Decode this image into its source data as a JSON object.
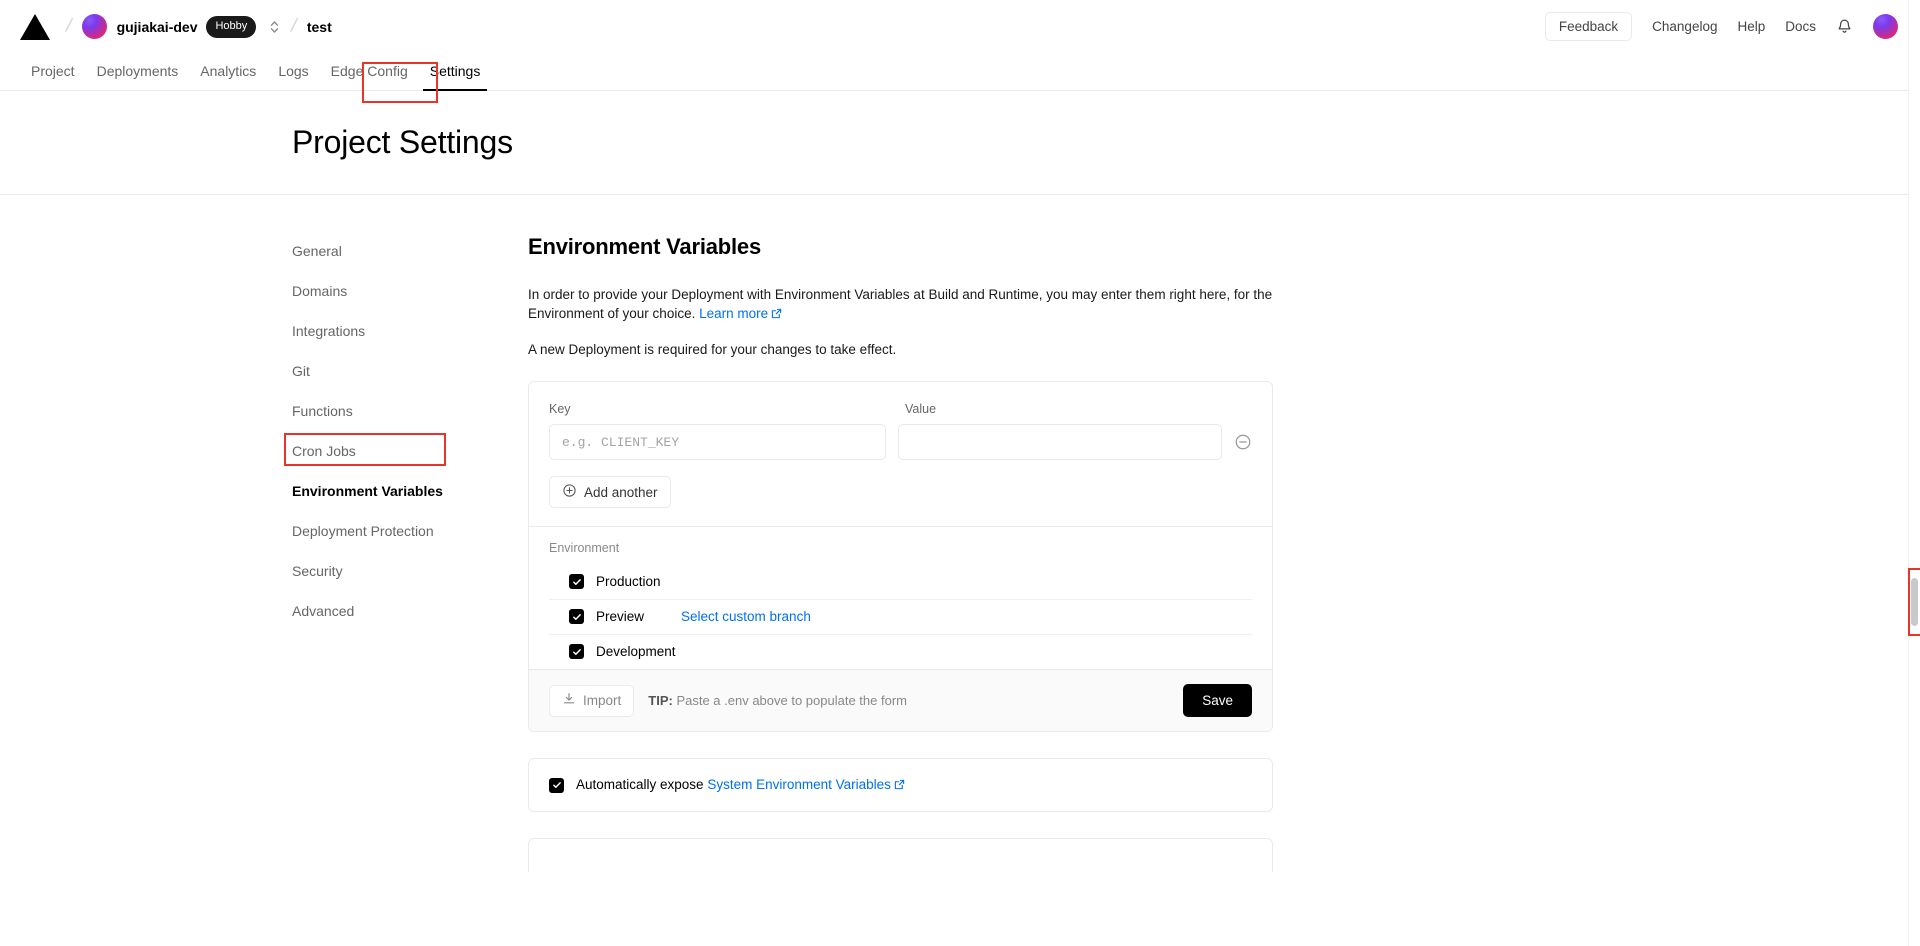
{
  "header": {
    "logo_icon": "vercel-triangle-icon",
    "team_avatar_icon": "team-avatar",
    "team_name": "gujiakai-dev",
    "plan_badge": "Hobby",
    "selector_icon": "chevron-up-down-icon",
    "project_name": "test",
    "feedback_label": "Feedback",
    "changelog_label": "Changelog",
    "help_label": "Help",
    "docs_label": "Docs",
    "bell_icon": "notification-bell-icon",
    "user_avatar_icon": "user-avatar"
  },
  "nav": {
    "tabs": [
      {
        "label": "Project",
        "active": false
      },
      {
        "label": "Deployments",
        "active": false
      },
      {
        "label": "Analytics",
        "active": false
      },
      {
        "label": "Logs",
        "active": false
      },
      {
        "label": "Edge Config",
        "active": false
      },
      {
        "label": "Settings",
        "active": true
      }
    ]
  },
  "page": {
    "title": "Project Settings"
  },
  "sidebar": {
    "items": [
      {
        "label": "General",
        "active": false
      },
      {
        "label": "Domains",
        "active": false
      },
      {
        "label": "Integrations",
        "active": false
      },
      {
        "label": "Git",
        "active": false
      },
      {
        "label": "Functions",
        "active": false
      },
      {
        "label": "Cron Jobs",
        "active": false
      },
      {
        "label": "Environment Variables",
        "active": true
      },
      {
        "label": "Deployment Protection",
        "active": false
      },
      {
        "label": "Security",
        "active": false
      },
      {
        "label": "Advanced",
        "active": false
      }
    ]
  },
  "main": {
    "section_title": "Environment Variables",
    "description_part1": "In order to provide your Deployment with Environment Variables at Build and Runtime, you may enter them right here, for the Environment of your choice. ",
    "learn_more_label": "Learn more",
    "external_link_icon": "external-link-icon",
    "redeploy_note": "A new Deployment is required for your changes to take effect.",
    "form": {
      "key_header": "Key",
      "value_header": "Value",
      "key_value": "",
      "key_placeholder": "e.g. CLIENT_KEY",
      "value_value": "",
      "value_placeholder": "",
      "remove_icon": "minus-circle-icon",
      "add_another_label": "Add another",
      "add_icon": "plus-circle-icon",
      "environment_label": "Environment",
      "environments": [
        {
          "label": "Production",
          "checked": true,
          "link": ""
        },
        {
          "label": "Preview",
          "checked": true,
          "link": "Select custom branch"
        },
        {
          "label": "Development",
          "checked": true,
          "link": ""
        }
      ],
      "import_label": "Import",
      "import_icon": "download-icon",
      "tip_prefix": "TIP:",
      "tip_text": " Paste a .env above to populate the form",
      "save_label": "Save"
    },
    "expose": {
      "checked": true,
      "text": "Automatically expose ",
      "link_label": "System Environment Variables",
      "external_link_icon": "external-link-icon"
    }
  },
  "colors": {
    "accent_blue": "#0070f3",
    "highlight_red": "#e8342a",
    "checkbox_black": "#000000"
  }
}
